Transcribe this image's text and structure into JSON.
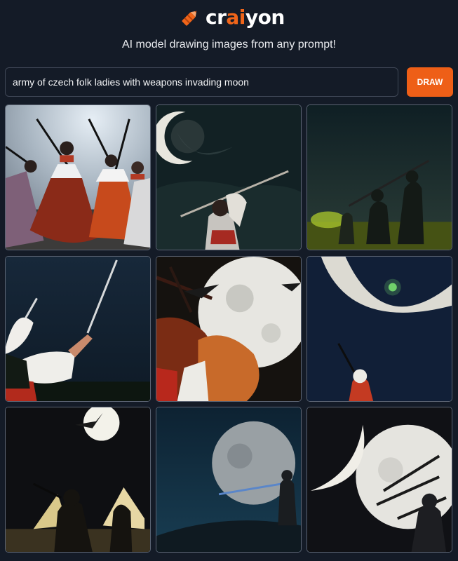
{
  "app": {
    "logo_prefix": "cr",
    "logo_accent": "ai",
    "logo_suffix": "yon",
    "tagline": "AI model drawing images from any prompt!",
    "accent_color": "#ee5f17",
    "background_color": "#141b27"
  },
  "prompt": {
    "value": "army of czech folk ladies with weapons invading moon"
  },
  "draw_button": {
    "label": "DRAW"
  },
  "results": [
    {
      "scene": "folk-dancers-daylight"
    },
    {
      "scene": "crescent-moon-warrior"
    },
    {
      "scene": "green-night-silhouettes"
    },
    {
      "scene": "sword-woman-night"
    },
    {
      "scene": "full-moon-fighters"
    },
    {
      "scene": "crescent-moon-green-star"
    },
    {
      "scene": "moon-silhouettes-lamps"
    },
    {
      "scene": "moon-lone-figure"
    },
    {
      "scene": "crescent-full-moon-spears"
    }
  ]
}
